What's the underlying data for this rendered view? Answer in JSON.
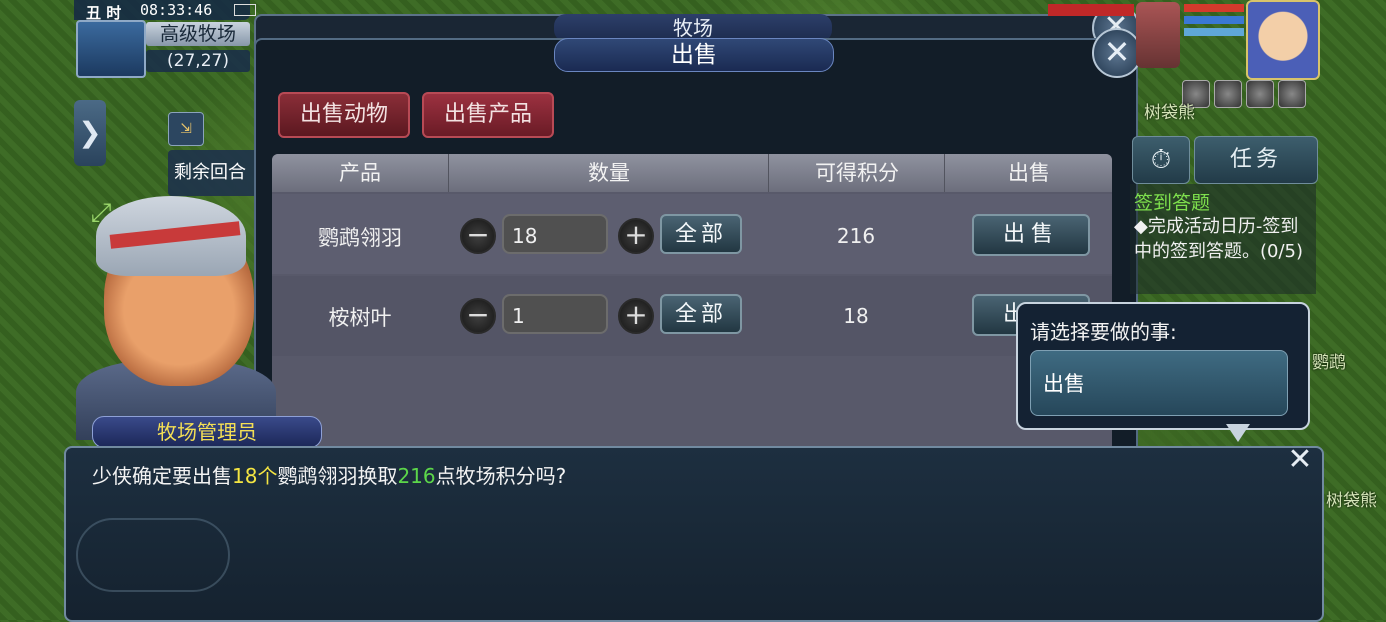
{
  "hud": {
    "hour": "丑 时",
    "time": "08:33:46",
    "map_name": "高级牧场",
    "coords": "(27,27)",
    "remaining_label": "剩余回合"
  },
  "background_panel": {
    "title": "牧场"
  },
  "sell_panel": {
    "title": "出售",
    "tabs": [
      {
        "label": "出售动物"
      },
      {
        "label": "出售产品"
      }
    ],
    "table": {
      "headers": [
        "产品",
        "数量",
        "可得积分",
        "出售"
      ],
      "rows": [
        {
          "product": "鹦鹉翎羽",
          "quantity": "18",
          "all_label": "全部",
          "points": "216",
          "sell_label": "出售"
        },
        {
          "product": "桉树叶",
          "quantity": "1",
          "all_label": "全部",
          "points": "18",
          "sell_label": "出售"
        }
      ]
    }
  },
  "right_hud": {
    "tree_label_1": "树袋熊",
    "timer_icon": "clock-icon",
    "task_button": "任务",
    "task_title": "签到答题",
    "task_desc": "◆完成活动日历-签到中的签到答题。(0/5)",
    "parrot_label": "鹦鹉",
    "tree_label_2": "树袋熊"
  },
  "npc": {
    "name": "牧场管理员"
  },
  "dialog": {
    "text_prefix": "少侠确定要出售",
    "count": "18个",
    "item": "鹦鹉翎羽换取",
    "points": "216",
    "text_suffix": "点牧场积分吗?"
  },
  "choice_bubble": {
    "title": "请选择要做的事:",
    "options": [
      {
        "label": "出售"
      }
    ]
  }
}
